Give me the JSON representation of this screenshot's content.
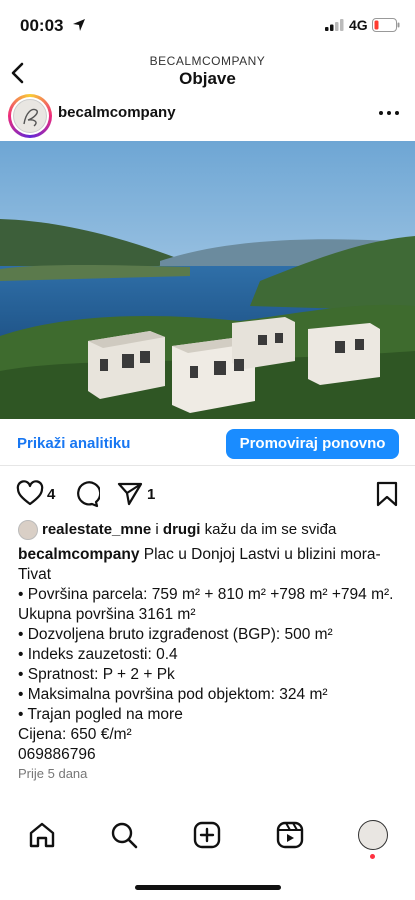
{
  "status": {
    "time": "00:03",
    "network": "4G"
  },
  "header": {
    "subtitle": "BECALMCOMPANY",
    "title": "Objave"
  },
  "post": {
    "username": "becalmcompany",
    "analytics_label": "Prikaži analitiku",
    "promote_label": "Promoviraj ponovno",
    "like_count": "4",
    "share_count": "1",
    "likes": {
      "user": "realestate_mne",
      "connector": " i ",
      "others": "drugi",
      "suffix": " kažu da im se sviđa"
    },
    "caption": {
      "author": "becalmcompany",
      "title": " Plac u Donjoj Lastvi u blizini mora-Tivat",
      "lines": [
        " • Površina parcela: 759 m² + 810 m² +798 m² +794 m². Ukupna površina 3161 m²",
        " • Dozvoljena bruto izgrađenost (BGP): 500 m²",
        " • Indeks zauzetosti: 0.4",
        " • Spratnost: P + 2 + Pk",
        " • Maksimalna površina pod objektom: 324 m²",
        " • Trajan pogled na more"
      ],
      "price": "Cijena: 650 €/m²",
      "phone": "069886796"
    },
    "time_ago": "Prije 5 dana"
  },
  "colors": {
    "link_blue": "#1877f2",
    "button_blue": "#1a8cff",
    "notification_red": "#ff3040"
  },
  "icons": [
    "location-arrow-icon",
    "signal-icon",
    "battery-icon",
    "back-chevron-icon",
    "more-icon",
    "heart-icon",
    "comment-icon",
    "share-icon",
    "bookmark-icon",
    "home-icon",
    "search-icon",
    "create-icon",
    "reels-icon"
  ]
}
